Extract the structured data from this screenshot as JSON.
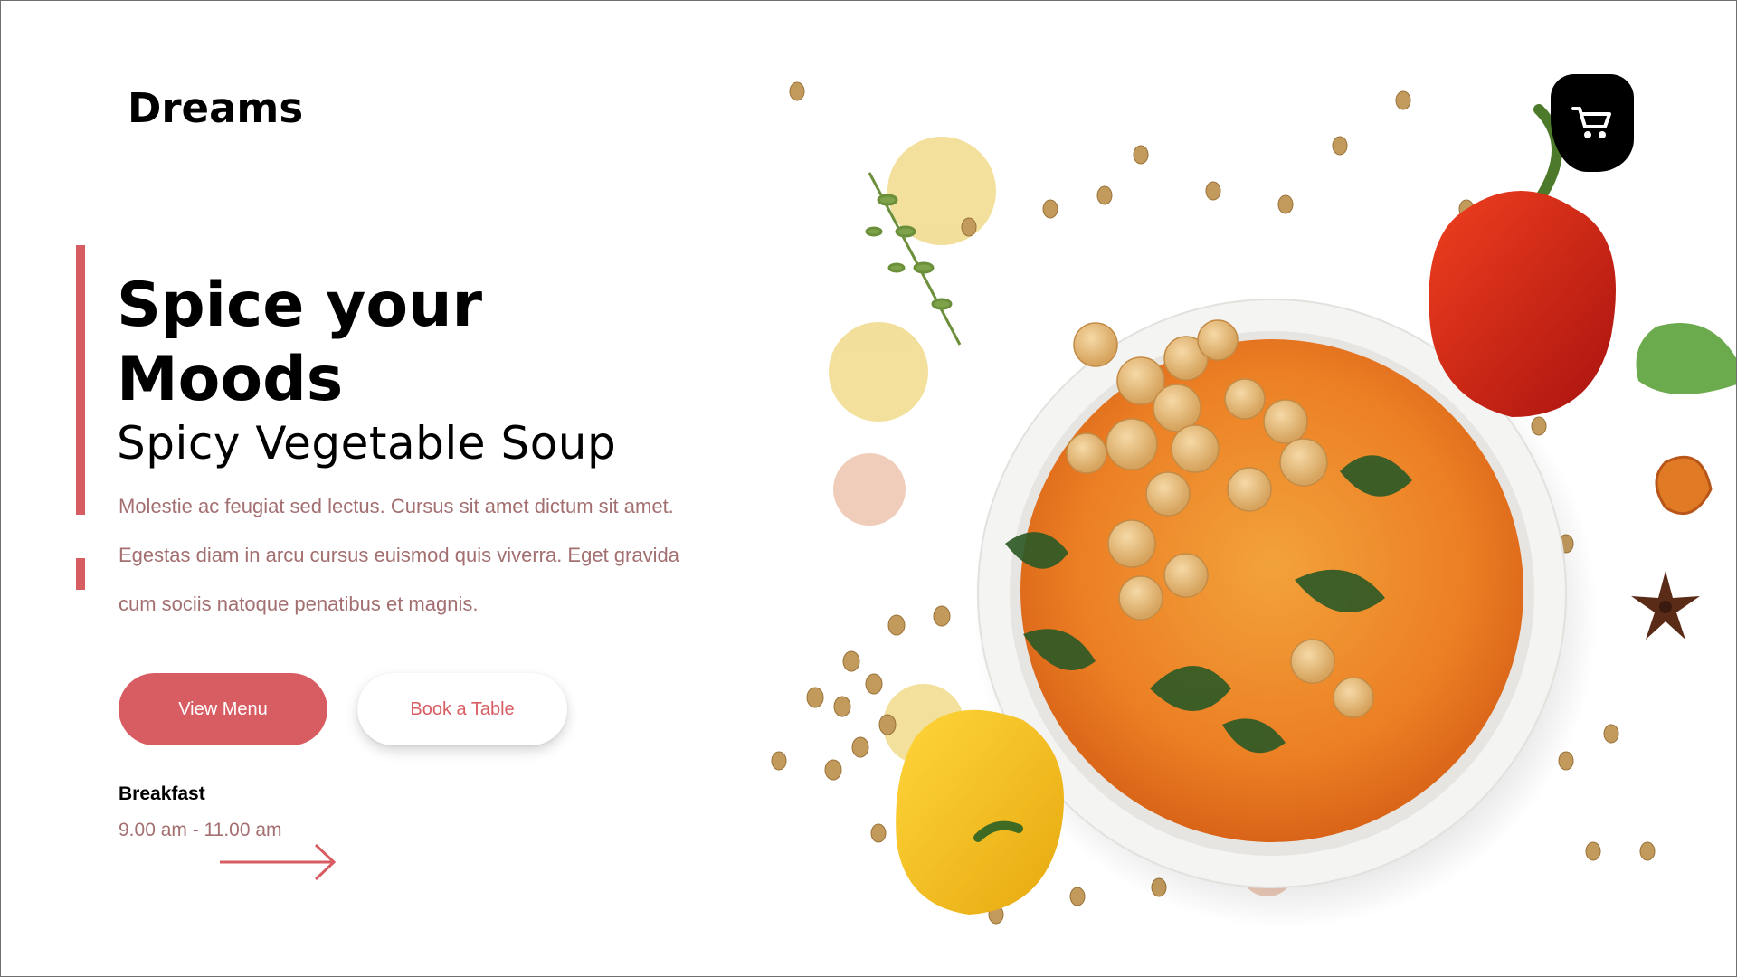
{
  "brand": {
    "name": "Dreams"
  },
  "hero": {
    "headline": "Spice your Moods",
    "subheadline": "Spicy Vegetable Soup",
    "description": "Molestie ac feugiat sed lectus. Cursus sit amet dictum sit amet. Egestas diam in arcu cursus euismod quis viverra. Eget gravida cum sociis natoque penatibus et magnis."
  },
  "actions": {
    "view_menu_label": "View Menu",
    "book_table_label": "Book a Table"
  },
  "schedule": {
    "meal": "Breakfast",
    "hours": "9.00 am - 11.00 am"
  },
  "icons": {
    "cart": "shopping-cart-icon",
    "next": "arrow-right-icon"
  },
  "colors": {
    "accent": "#d85d63",
    "muted_text": "#a36f70",
    "text": "#000000",
    "cart_bg": "#000000"
  }
}
